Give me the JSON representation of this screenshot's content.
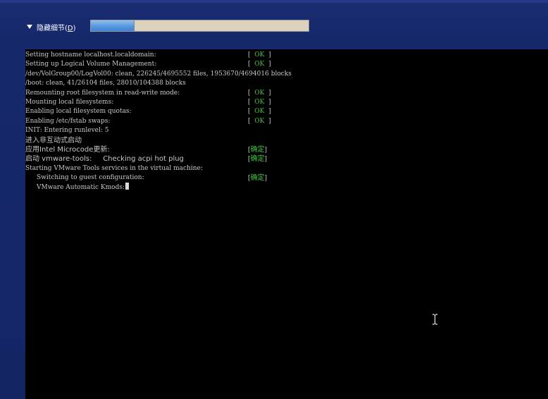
{
  "header": {
    "toggle_label_prefix": "隐藏细节(",
    "toggle_label_key": "D",
    "toggle_label_suffix": ")",
    "progress_fraction": 0.2
  },
  "console": {
    "lines": [
      {
        "text": "Setting hostname localhost.localdomain:",
        "status": "ok"
      },
      {
        "text": "Setting up Logical Volume Management:",
        "status": "ok"
      },
      {
        "text": "/dev/VolGroup00/LogVol00: clean, 226245/4695552 files, 1953670/4694016 blocks",
        "status": ""
      },
      {
        "text": "/boot: clean, 41/26104 files, 28010/104388 blocks",
        "status": ""
      },
      {
        "text": "Remounting root filesystem in read-write mode:",
        "status": "ok"
      },
      {
        "text": "Mounting local filesystems:",
        "status": "ok"
      },
      {
        "text": "Enabling local filesystem quotas:",
        "status": "ok"
      },
      {
        "text": "Enabling /etc/fstab swaps:",
        "status": "ok"
      },
      {
        "text": "INIT: Entering runlevel: 5",
        "status": ""
      },
      {
        "text": "进入非互动式启动",
        "status": ""
      },
      {
        "text": "应用Intel Microcode更新:",
        "status": "confirm"
      },
      {
        "text": "启动 vmware-tools:     Checking acpi hot plug",
        "status": "confirm"
      },
      {
        "text": "Starting VMware Tools services in the virtual machine:",
        "status": ""
      },
      {
        "text": "Switching to guest configuration:",
        "status": "confirm",
        "indent": true
      },
      {
        "text": "VMware Automatic Kmods:",
        "status": "",
        "indent": true,
        "cursor": true
      }
    ],
    "ok_open": "[  ",
    "ok_word": "OK",
    "ok_close": "  ]",
    "confirm_open": "[",
    "confirm_word": "确定",
    "confirm_close": "]"
  },
  "colors": {
    "background": "#142566",
    "console_bg": "#000000",
    "console_text": "#c8c8c8",
    "ok_green": "#3ec43e",
    "progress_fill": "#5a9be0",
    "progress_track": "#dcd2bd"
  },
  "icons": {
    "toggle": "triangle-down-icon",
    "mouse": "i-beam-cursor-icon"
  }
}
